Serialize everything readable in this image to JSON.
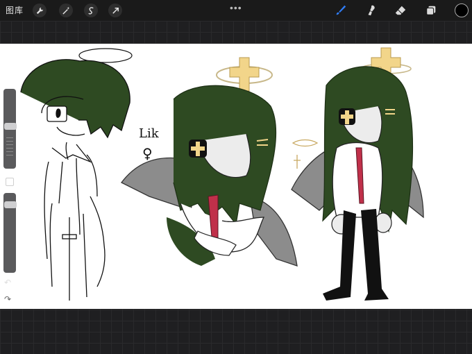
{
  "toolbar": {
    "gallery_label": "图库",
    "left_tools": [
      "wrench-icon",
      "magic-wand-icon",
      "selection-icon",
      "transform-arrow-icon"
    ],
    "menu_dots": "•••",
    "right_tools": [
      "brush-icon",
      "smudge-icon",
      "eraser-icon",
      "layers-icon"
    ],
    "active_tool": "brush",
    "current_color": "#000000"
  },
  "sidebar": {
    "brush_size_level": 0.5,
    "opacity_level": 0.95,
    "undo_icon": "undo-icon",
    "redo_icon": "redo-icon"
  },
  "canvas": {
    "handwritten_note": "Lik",
    "note_symbol": "♀",
    "colors": {
      "hair": "#2e4a22",
      "wings": "#8c8c8c",
      "halo": "#f2d58a",
      "tie": "#c0304a",
      "pants": "#111111",
      "coat": "#ffffff"
    }
  }
}
